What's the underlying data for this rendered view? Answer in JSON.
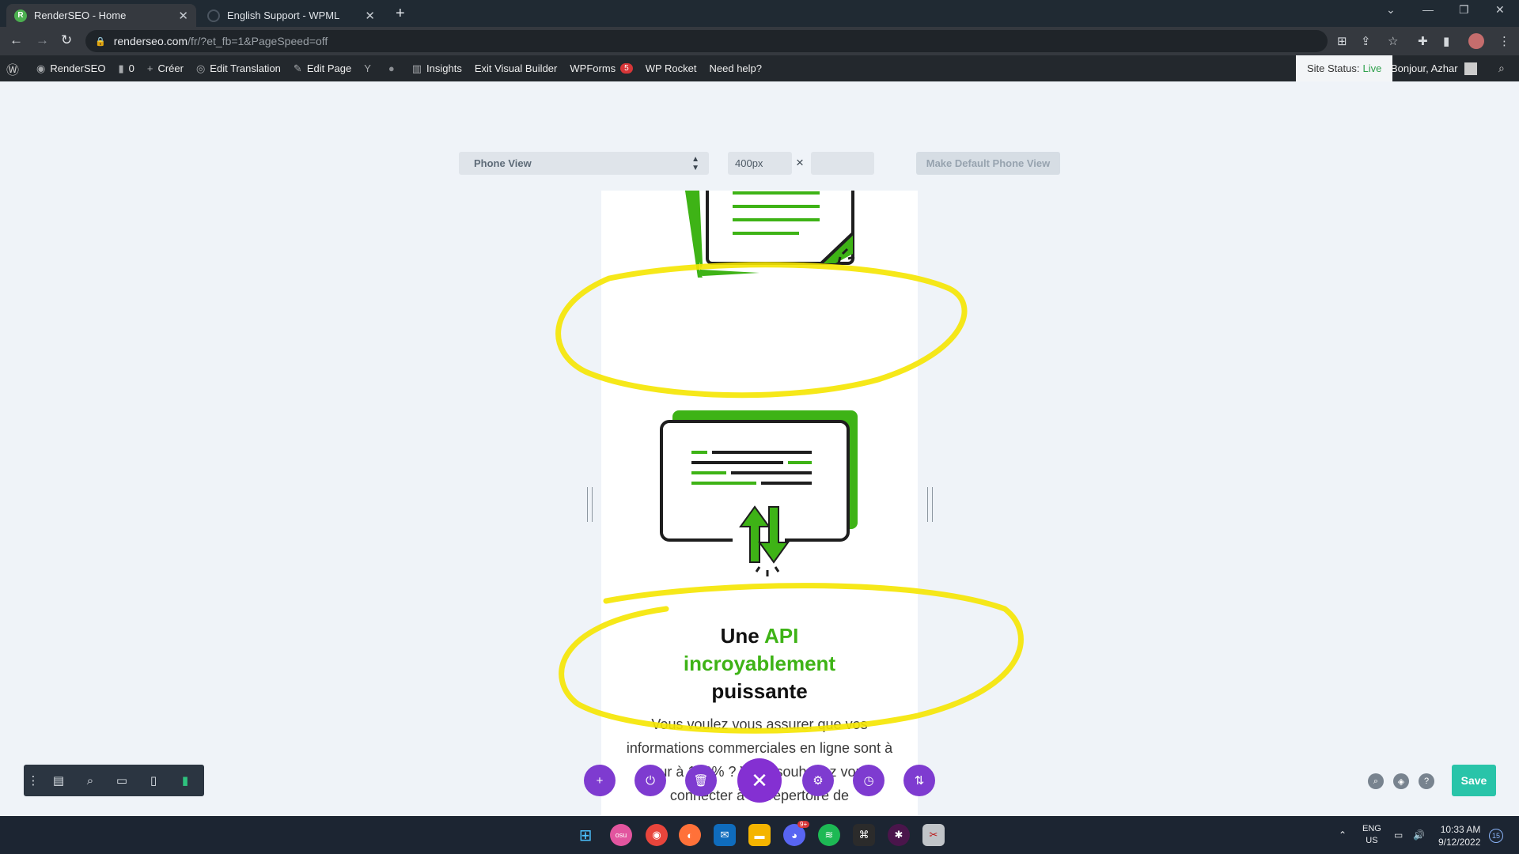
{
  "browser": {
    "tabs": [
      {
        "title": "RenderSEO - Home",
        "favicon": "R",
        "active": true
      },
      {
        "title": "English Support - WPML",
        "favicon": "",
        "active": false
      }
    ],
    "new_tab": "+",
    "url_host": "renderseo.com",
    "url_path": "/fr/?et_fb=1&PageSpeed=off"
  },
  "adminbar": {
    "site_name": "RenderSEO",
    "comments_count": "0",
    "create": "Créer",
    "edit_translation": "Edit Translation",
    "edit_page": "Edit Page",
    "insights": "Insights",
    "exit_builder": "Exit Visual Builder",
    "wpforms": "WPForms",
    "wpforms_badge": "5",
    "wp_rocket": "WP Rocket",
    "need_help": "Need help?",
    "site_status_label": "Site Status:",
    "site_status_value": "Live",
    "greeting": "Bonjour, Azhar"
  },
  "builder": {
    "view_select": "Phone View",
    "width_value": "400px",
    "times": "×",
    "make_default": "Make Default Phone View",
    "save": "Save"
  },
  "content": {
    "heading_part1": "Une",
    "heading_api": "API",
    "heading_green2": "incroyablement",
    "heading_part3": "puissante",
    "paragraph": "Vous voulez vous assurer que vos informations commerciales en ligne sont à jour à 100% ? Vous souhaitez vous connecter à un répertoire de"
  },
  "taskbar": {
    "lang_top": "ENG",
    "lang_bottom": "US",
    "time": "10:33 AM",
    "date": "9/12/2022",
    "notifications": "15",
    "discord_badge": "9+"
  },
  "colors": {
    "accent_green": "#3eb316",
    "builder_purple": "#7e3bd0",
    "save_teal": "#29c4a9",
    "highlight_yellow": "#f5e600"
  }
}
